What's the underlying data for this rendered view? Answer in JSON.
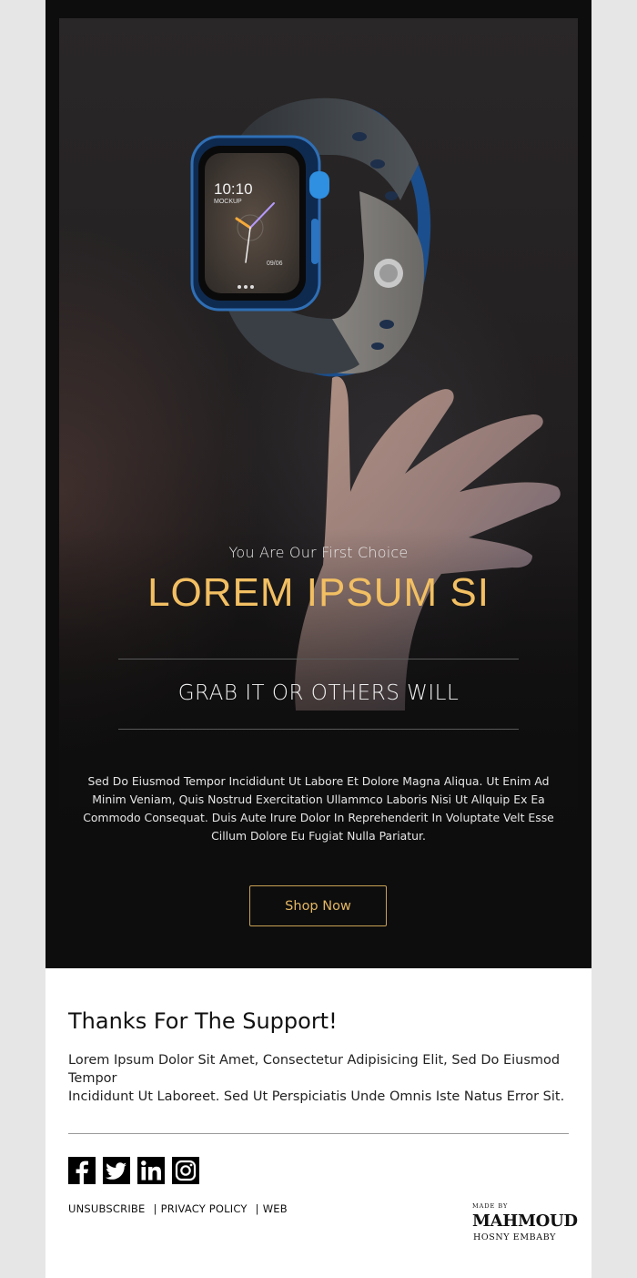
{
  "hero": {
    "subtitle": "You Are Our First Choice",
    "headline": "LOREM IPSUM SI",
    "tagline": "GRAB IT OR OTHERS WILL",
    "body": "Sed Do Eiusmod Tempor Incididunt Ut Labore Et Dolore Magna Aliqua. Ut Enim Ad Minim Veniam, Quis Nostrud Exercitation Ullammco Laboris Nisi Ut Allquip Ex Ea Commodo Consequat. Duis Aute Irure Dolor In Reprehenderit In Voluptate Velt Esse Cillum Dolore Eu Fugiat Nulla Pariatur.",
    "cta_label": "Shop Now",
    "watch_screen": {
      "time": "10:10",
      "label": "MOCKUP",
      "date": "09/06"
    }
  },
  "footer": {
    "heading": "Thanks For The Support!",
    "text_line1": "Lorem Ipsum Dolor Sit Amet, Consectetur Adipisicing Elit, Sed Do Eiusmod Tempor",
    "text_line2": "Incididunt Ut Laboreet. Sed Ut Perspiciatis Unde Omnis Iste Natus Error Sit.",
    "socials": [
      "facebook-icon",
      "twitter-icon",
      "linkedin-icon",
      "instagram-icon"
    ],
    "links": {
      "unsubscribe": "UNSUBSCRIBE",
      "privacy": "PRIVACY POLICY",
      "web": "WEB",
      "separator": "|"
    },
    "maker": {
      "made_by": "MADE BY",
      "name": "MAHMOUD",
      "subname": "HOSNY EMBABY"
    }
  },
  "colors": {
    "accent": "#f2bf62",
    "hero_bg": "#0d0d0d",
    "page_bg": "#e6e6e6"
  }
}
